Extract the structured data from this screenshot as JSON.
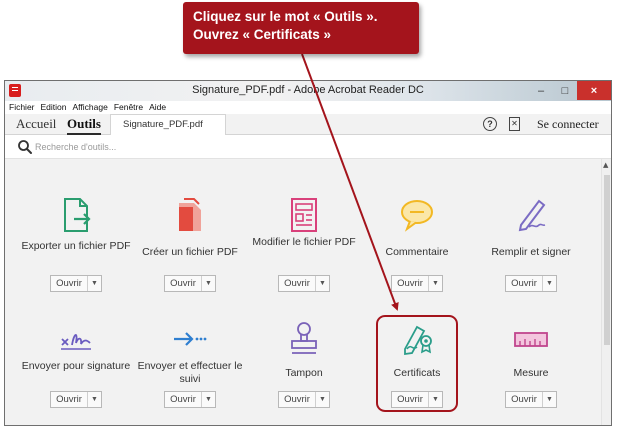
{
  "callout": {
    "line1": "Cliquez sur le mot « Outils ».",
    "line2": "Ouvrez « Certificats »"
  },
  "window": {
    "title": "Signature_PDF.pdf - Adobe Acrobat Reader DC",
    "minimize": "–",
    "maximize": "□",
    "close": "×"
  },
  "menu": [
    "Fichier",
    "Edition",
    "Affichage",
    "Fenêtre",
    "Aide"
  ],
  "tabs": {
    "home": "Accueil",
    "tools": "Outils",
    "document": "Signature_PDF.pdf",
    "help": "?",
    "connect": "Se connecter"
  },
  "search": {
    "placeholder": "Recherche d'outils..."
  },
  "open_label": "Ouvrir",
  "dropdown_arrow": "▼",
  "tools_row1": [
    {
      "label": "Exporter un fichier PDF",
      "icon": "export-pdf-icon",
      "color": "#2a9d6f"
    },
    {
      "label": "Créer un fichier PDF",
      "icon": "create-pdf-icon",
      "color": "#e34b3f"
    },
    {
      "label": "Modifier le fichier PDF",
      "icon": "edit-pdf-icon",
      "color": "#d9417b"
    },
    {
      "label": "Commentaire",
      "icon": "comment-icon",
      "color": "#f2b824"
    },
    {
      "label": "Remplir et signer",
      "icon": "fill-sign-icon",
      "color": "#7b6cc4"
    }
  ],
  "tools_row2": [
    {
      "label": "Envoyer pour signature",
      "icon": "send-signature-icon",
      "color": "#6a5bc0"
    },
    {
      "label": "Envoyer et effectuer le suivi",
      "icon": "send-track-icon",
      "color": "#2f7fd0"
    },
    {
      "label": "Tampon",
      "icon": "stamp-icon",
      "color": "#7a62b8"
    },
    {
      "label": "Certificats",
      "icon": "certificate-icon",
      "color": "#2a9d8a"
    },
    {
      "label": "Mesure",
      "icon": "measure-icon",
      "color": "#c0458d"
    }
  ],
  "colors": {
    "callout": "#a4141c",
    "highlight": "#a4141c"
  }
}
